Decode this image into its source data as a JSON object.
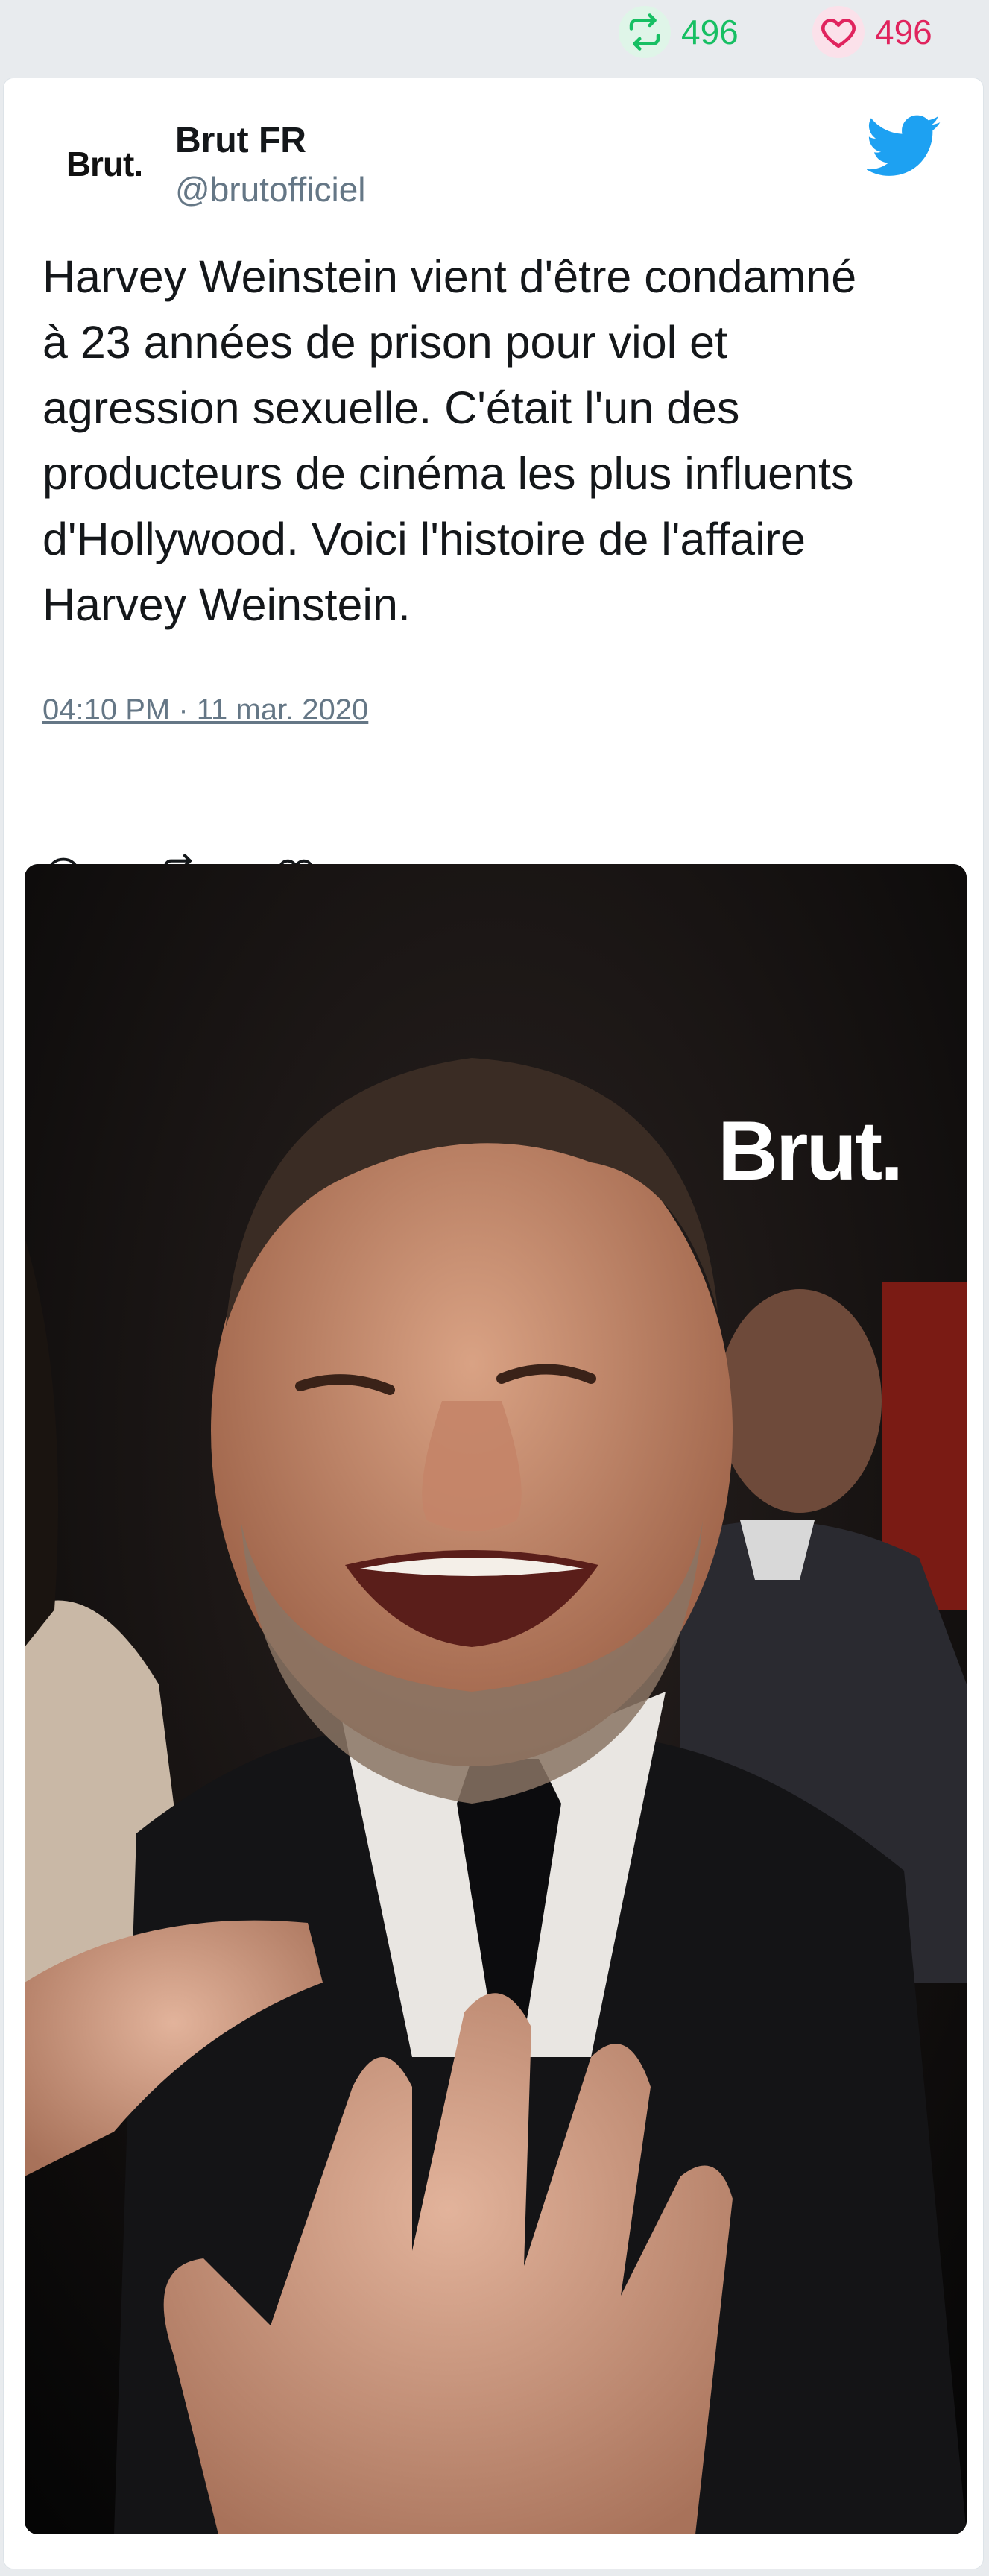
{
  "stats": {
    "retweets": "496",
    "likes": "496"
  },
  "tweet": {
    "avatar_text": "Brut.",
    "display_name": "Brut FR",
    "handle": "@brutofficiel",
    "text": "Harvey Weinstein vient d'être condamné\nà 23 années de prison pour viol et\nagression sexuelle. C'était l'un des\nproducteurs de cinéma les plus influents\nd'Hollywood. Voici l'histoire de l'affaire\nHarvey Weinstein.",
    "timestamp": "04:10 PM · 11 mar. 2020",
    "media_watermark": "Brut."
  },
  "icons": {
    "retweet": "retweet-icon",
    "like": "heart-icon",
    "reply": "reply-icon",
    "brand": "twitter-bird-icon"
  },
  "colors": {
    "retweet": "#17bf63",
    "like": "#e0245e",
    "twitter_blue": "#1da1f2",
    "secondary_text": "#657786"
  }
}
